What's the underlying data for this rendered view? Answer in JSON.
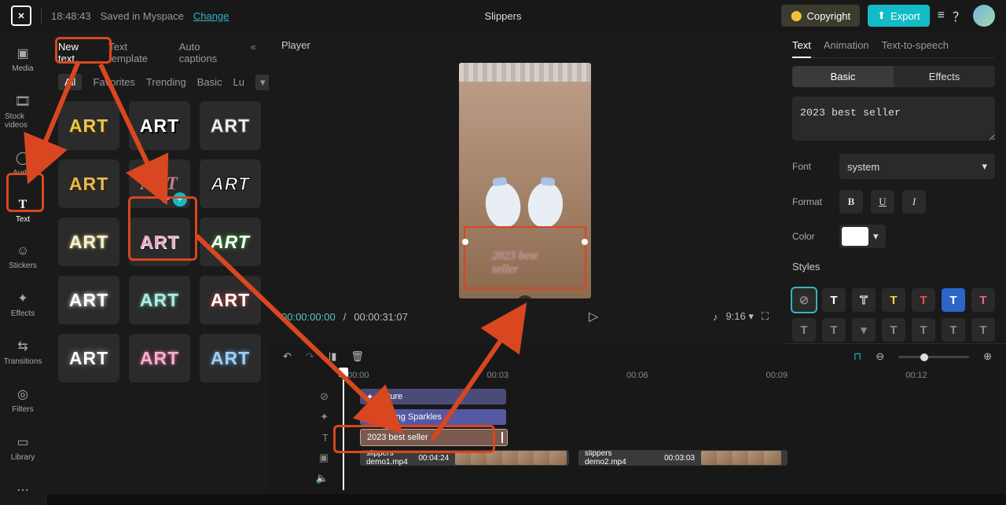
{
  "topbar": {
    "time": "18:48:43",
    "saved": "Saved in Myspace",
    "change": "Change",
    "project": "Slippers",
    "copyright": "Copyright",
    "export": "Export"
  },
  "sidebar": {
    "items": [
      "Media",
      "Stock videos",
      "Audio",
      "Text",
      "Stickers",
      "Effects",
      "Transitions",
      "Filters",
      "Library"
    ]
  },
  "textTabs": {
    "items": [
      "New text",
      "Text template",
      "Auto captions"
    ]
  },
  "textSub": {
    "items": [
      "All",
      "Favorites",
      "Trending",
      "Basic",
      "Lu"
    ]
  },
  "art_label": "ART",
  "player": {
    "title": "Player",
    "overlay": "2023 best seller",
    "tc_cur": "00:00:00:00",
    "tc_dur": "00:00:31:07",
    "ratio": "9:16"
  },
  "inspect": {
    "tabs": [
      "Text",
      "Animation",
      "Text-to-speech"
    ],
    "seg": [
      "Basic",
      "Effects"
    ],
    "content": "2023 best seller",
    "font_label": "Font",
    "font_value": "system",
    "format_label": "Format",
    "color_label": "Color",
    "styles_label": "Styles"
  },
  "timeline": {
    "ticks": [
      "00:00",
      "00:03",
      "00:06",
      "00:09",
      "00:12"
    ],
    "nature": "Nature",
    "spark": "Shining Sparkles",
    "text": "2023 best seller",
    "v1": "slippers demo1.mp4",
    "v1d": "00:04:24",
    "v2": "slippers demo2.mp4",
    "v2d": "00:03:03"
  }
}
